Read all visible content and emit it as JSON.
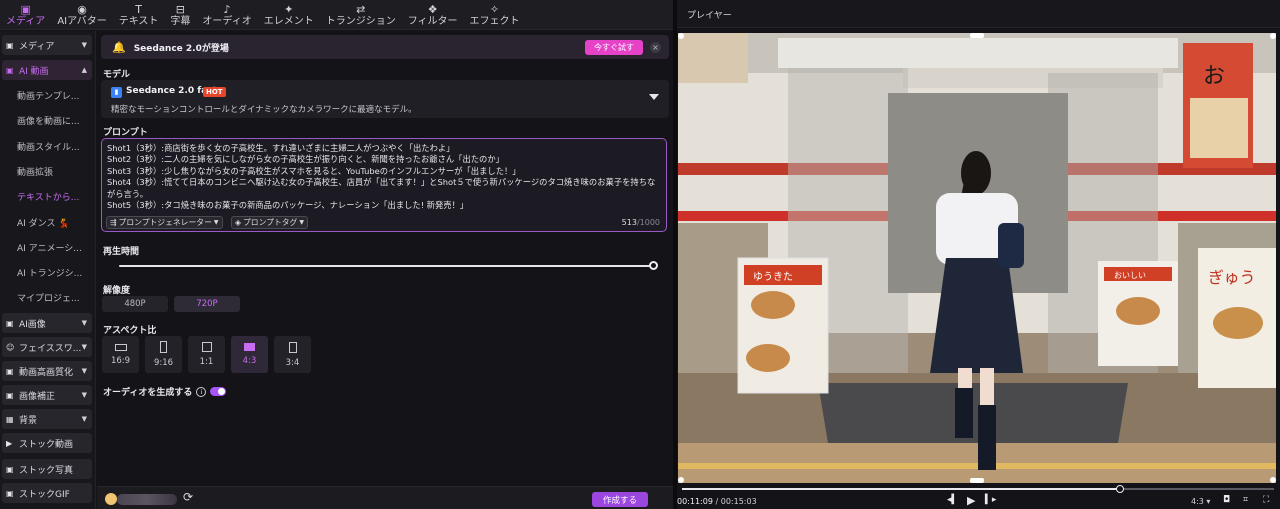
{
  "toolbar": {
    "items": [
      {
        "label": "メディア",
        "icon": "media-icon",
        "glyph": "▣",
        "active": true
      },
      {
        "label": "AIアバター",
        "icon": "avatar-icon",
        "glyph": "◉",
        "active": false
      },
      {
        "label": "テキスト",
        "icon": "text-icon",
        "glyph": "T",
        "active": false
      },
      {
        "label": "字幕",
        "icon": "subtitle-icon",
        "glyph": "⊟",
        "active": false
      },
      {
        "label": "オーディオ",
        "icon": "audio-icon",
        "glyph": "♪",
        "active": false
      },
      {
        "label": "エレメント",
        "icon": "element-icon",
        "glyph": "✦",
        "active": false
      },
      {
        "label": "トランジション",
        "icon": "transition-icon",
        "glyph": "⇄",
        "active": false
      },
      {
        "label": "フィルター",
        "icon": "filter-icon",
        "glyph": "❖",
        "active": false
      },
      {
        "label": "エフェクト",
        "icon": "effect-icon",
        "glyph": "✧",
        "active": false
      }
    ]
  },
  "sidebar": {
    "groups": [
      {
        "label": "メディア",
        "icon": "media-icon",
        "glyph": "▣",
        "selected": false
      },
      {
        "label": "AI 動画",
        "icon": "ai-video-icon",
        "glyph": "▣",
        "selected": true
      },
      {
        "label": "AI画像",
        "icon": "ai-image-icon",
        "glyph": "▣",
        "selected": false
      },
      {
        "label": "フェイススワ...",
        "icon": "face-swap-icon",
        "glyph": "☺",
        "selected": false
      },
      {
        "label": "動画高画質化",
        "icon": "enhance-icon",
        "glyph": "▣",
        "selected": false
      },
      {
        "label": "画像補正",
        "icon": "image-correct-icon",
        "glyph": "▣",
        "selected": false
      },
      {
        "label": "背景",
        "icon": "background-icon",
        "glyph": "▦",
        "selected": false
      },
      {
        "label": "ストック動画",
        "icon": "stock-video-icon",
        "glyph": "▶",
        "selected": false
      },
      {
        "label": "ストック写真",
        "icon": "stock-photo-icon",
        "glyph": "▣",
        "selected": false
      },
      {
        "label": "ストックGIF",
        "icon": "stock-gif-icon",
        "glyph": "▣",
        "selected": false
      }
    ],
    "sub_items": [
      {
        "label": "動画テンプレ...",
        "selected": false
      },
      {
        "label": "画像を動画に...",
        "selected": false
      },
      {
        "label": "動画スタイル...",
        "selected": false
      },
      {
        "label": "動画拡張",
        "selected": false
      },
      {
        "label": "テキストから...",
        "selected": true
      },
      {
        "label": "AI ダンス 💃",
        "selected": false
      },
      {
        "label": "AI アニメーシ...",
        "selected": false
      },
      {
        "label": "AI トランジシ...",
        "selected": false
      },
      {
        "label": "マイプロジェ...",
        "selected": false
      }
    ]
  },
  "banner": {
    "text": "Seedance 2.0が登場",
    "cta": "今すぐ試す"
  },
  "model": {
    "section_label": "モデル",
    "name": "Seedance 2.0 fast",
    "badge": "HOT",
    "description": "精密なモーションコントロールとダイナミックなカメラワークに最適なモデル。"
  },
  "prompt": {
    "section_label": "プロンプト",
    "lines": [
      "Shot1（3秒）:商店街を歩く女の子高校生。すれ違いざまに主婦二人がつぶやく「出たわよ」",
      "Shot2（3秒）:二人の主婦を気にしながら女の子高校生が振り向くと、新聞を持ったお爺さん「出たのか」",
      "Shot3（3秒）:少し焦りながら女の子高校生がスマホを見ると、YouTubeのインフルエンサーが「出ました！」",
      "Shot4（3秒）:慌てて日本のコンビニへ駆け込む女の子高校生、店員が「出てます！」とShot５で使う新パッケージのタコ焼き味のお菓子を持ちながら言う。",
      "Shot5（3秒）:タコ焼き味のお菓子の新商品のパッケージ、ナレーション「出ました! 新発売！」"
    ],
    "generator_label": "プロンプトジェネレーター",
    "tag_label": "プロンプトタグ",
    "count": "513",
    "max": "/1000"
  },
  "duration": {
    "section_label": "再生時間",
    "value_fraction": 1.0
  },
  "resolution": {
    "section_label": "解像度",
    "options": [
      "480P",
      "720P"
    ],
    "selected": "720P"
  },
  "aspect": {
    "section_label": "アスペクト比",
    "options": [
      "16:9",
      "9:16",
      "1:1",
      "4:3",
      "3:4"
    ],
    "selected": "4:3"
  },
  "audio": {
    "label": "オーディオを生成する",
    "enabled": true
  },
  "footer": {
    "generate": "作成する"
  },
  "player": {
    "title": "プレイヤー",
    "current_time": "00:11:09",
    "total_time": "/ 00:15:03",
    "progress": 0.74,
    "aspect": "4:3",
    "signs": [
      "ゆうきた",
      "お",
      "おいしい",
      "ぎゅう"
    ]
  },
  "colors": {
    "accent": "#c86cf2",
    "primary_button": "#9c46e0",
    "cta": "#e642c8",
    "hot": "#e8452c"
  }
}
